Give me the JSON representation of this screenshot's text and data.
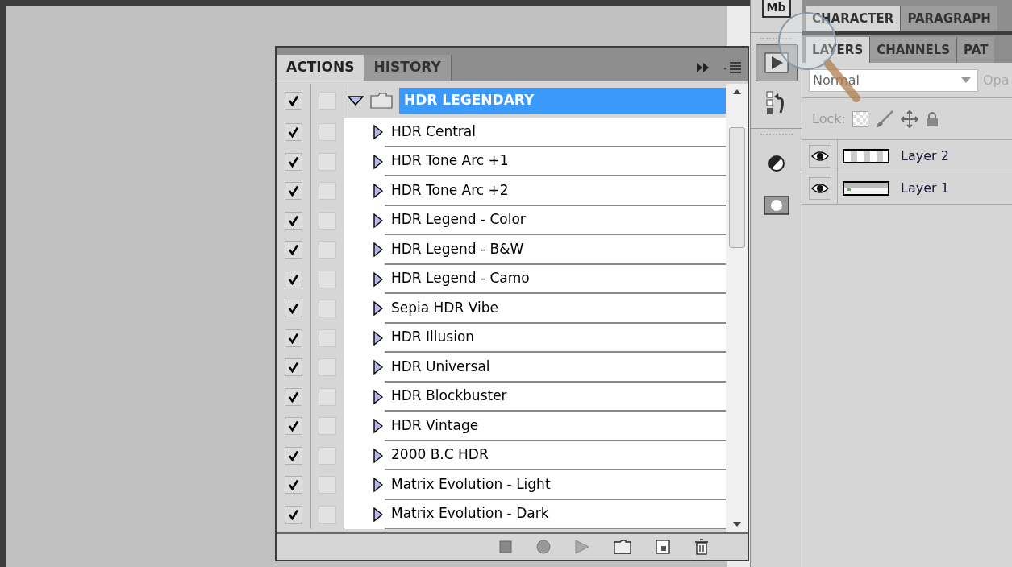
{
  "actions_panel": {
    "tabs": [
      {
        "label": "ACTIONS",
        "selected": true
      },
      {
        "label": "HISTORY",
        "selected": false
      }
    ],
    "set": {
      "name": "HDR LEGENDARY",
      "checked": true,
      "expanded": true,
      "selected": true
    },
    "actions": [
      {
        "name": "HDR Central",
        "checked": true
      },
      {
        "name": "HDR Tone Arc +1",
        "checked": true
      },
      {
        "name": "HDR Tone Arc +2",
        "checked": true
      },
      {
        "name": "HDR Legend - Color",
        "checked": true
      },
      {
        "name": "HDR Legend - B&W",
        "checked": true
      },
      {
        "name": "HDR Legend - Camo",
        "checked": true
      },
      {
        "name": "Sepia HDR Vibe",
        "checked": true
      },
      {
        "name": "HDR Illusion",
        "checked": true
      },
      {
        "name": "HDR Universal",
        "checked": true
      },
      {
        "name": "HDR Blockbuster",
        "checked": true
      },
      {
        "name": "HDR Vintage",
        "checked": true
      },
      {
        "name": "2000 B.C HDR",
        "checked": true
      },
      {
        "name": "Matrix Evolution - Light",
        "checked": true
      },
      {
        "name": "Matrix Evolution - Dark",
        "checked": true
      }
    ]
  },
  "toolbar": {
    "top_icon": "Mb",
    "tools": [
      {
        "kind": "play",
        "selected": true
      },
      {
        "kind": "history",
        "selected": false
      },
      {
        "kind": "adjust",
        "selected": false
      },
      {
        "kind": "mask",
        "selected": false
      }
    ]
  },
  "type_panel": {
    "tabs": [
      {
        "label": "CHARACTER",
        "selected": true
      },
      {
        "label": "PARAGRAPH",
        "selected": false
      }
    ]
  },
  "layers_panel": {
    "tabs": [
      {
        "label": "LAYERS",
        "selected": true
      },
      {
        "label": "CHANNELS",
        "selected": false
      },
      {
        "label": "PAT",
        "selected": false
      }
    ],
    "blend_mode": "Normal",
    "opacity_label": "Opa",
    "lock_label": "Lock:",
    "layers": [
      {
        "name": "Layer 2",
        "visible": true,
        "kind": "transparent"
      },
      {
        "name": "Layer 1",
        "visible": true,
        "kind": "screenshot"
      }
    ]
  }
}
